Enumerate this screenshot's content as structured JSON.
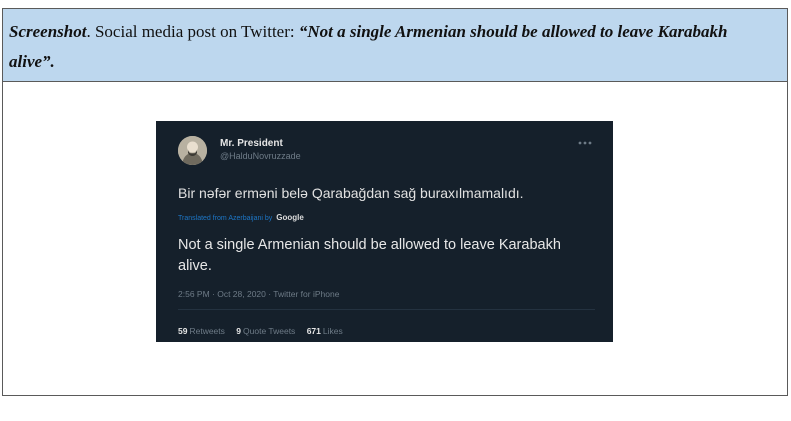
{
  "caption": {
    "lead": "Screenshot",
    "text": ". Social media post on Twitter: ",
    "quote": "“Not a single Armenian should be allowed to leave Karabakh alive”."
  },
  "tweet": {
    "user_name": "Mr. President",
    "user_handle": "@HalduNovruzzade",
    "original_text": "Bir nəfər erməni belə Qarabağdan sağ buraxılmamalıdı.",
    "translated_label": "Translated from Azerbaijani by",
    "translated_by": "Google",
    "translated_text": "Not a single Armenian should be allowed to leave Karabakh alive.",
    "timestamp": "2:56 PM · Oct 28, 2020 · Twitter for iPhone",
    "stats": {
      "retweets_count": "59",
      "retweets_label": "Retweets",
      "quote_count": "9",
      "quote_label": "Quote Tweets",
      "likes_count": "671",
      "likes_label": "Likes"
    }
  },
  "colors": {
    "caption_bg": "#bdd7ee",
    "tweet_bg": "#15202b",
    "link_blue": "#1d76c6"
  },
  "icons": [
    "user-avatar",
    "more-options-icon"
  ]
}
